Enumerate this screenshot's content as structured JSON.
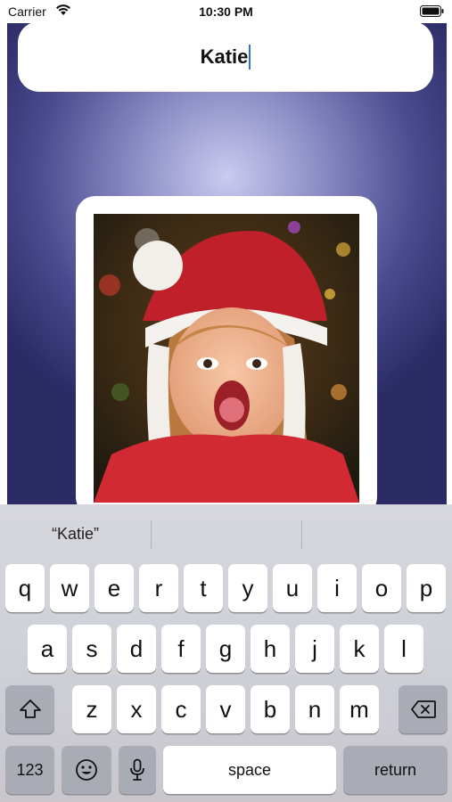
{
  "status_bar": {
    "carrier": "Carrier",
    "time": "10:30 PM"
  },
  "name_field": {
    "value": "Katie"
  },
  "keyboard": {
    "suggestions": [
      "“Katie”",
      "",
      ""
    ],
    "row1": [
      "q",
      "w",
      "e",
      "r",
      "t",
      "y",
      "u",
      "i",
      "o",
      "p"
    ],
    "row2": [
      "a",
      "s",
      "d",
      "f",
      "g",
      "h",
      "j",
      "k",
      "l"
    ],
    "row3": [
      "z",
      "x",
      "c",
      "v",
      "b",
      "n",
      "m"
    ],
    "numbers_label": "123",
    "space_label": "space",
    "return_label": "return"
  }
}
